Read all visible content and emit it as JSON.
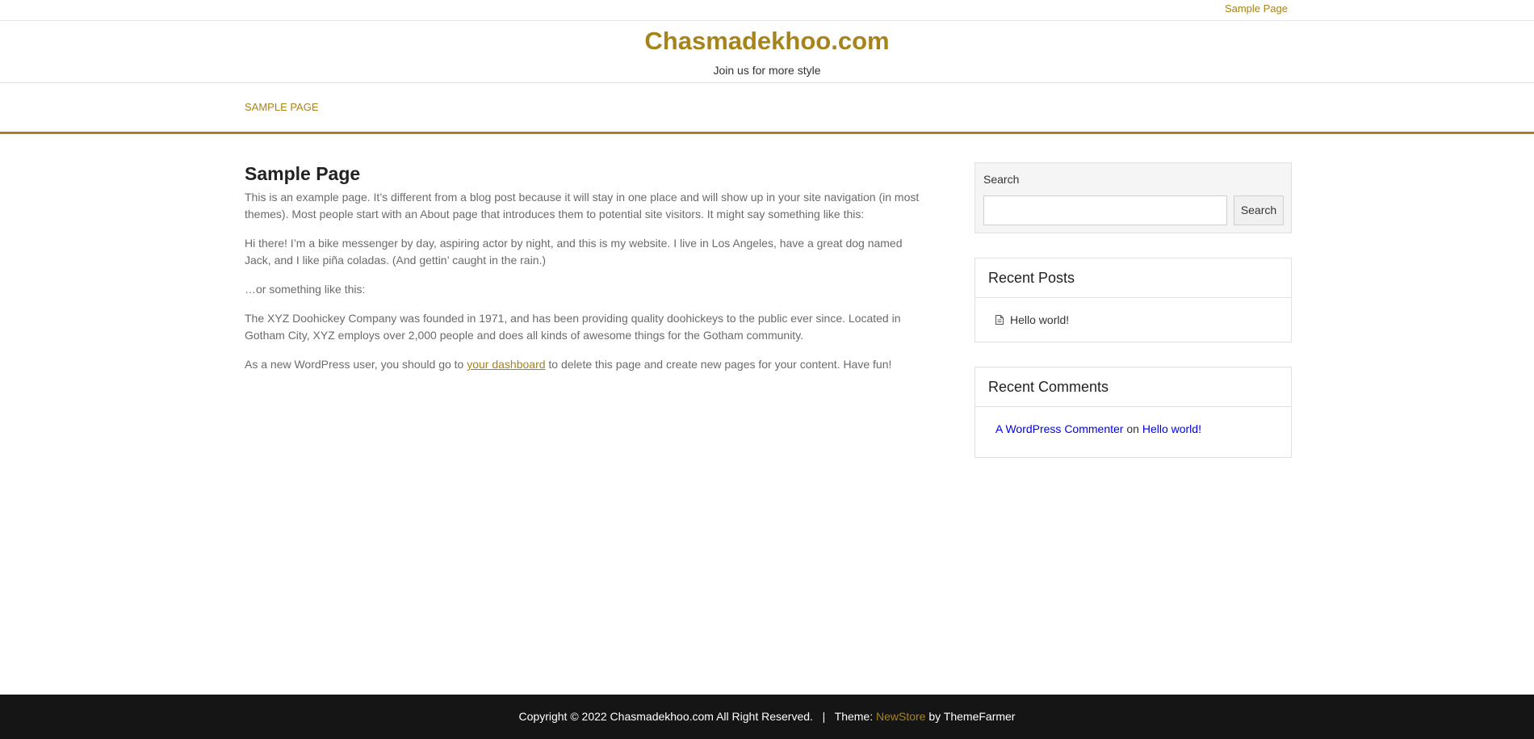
{
  "topbar": {
    "link": "Sample Page"
  },
  "header": {
    "title": "Chasmadekhoo.com",
    "tagline": "Join us for more style"
  },
  "nav": {
    "items": [
      "SAMPLE PAGE"
    ]
  },
  "main": {
    "title": "Sample Page",
    "paragraphs": {
      "p1": "This is an example page. It’s different from a blog post because it will stay in one place and will show up in your site navigation (in most themes). Most people start with an About page that introduces them to potential site visitors. It might say something like this:",
      "p2": "Hi there! I’m a bike messenger by day, aspiring actor by night, and this is my website. I live in Los Angeles, have a great dog named Jack, and I like piña coladas. (And gettin’ caught in the rain.)",
      "p3": "…or something like this:",
      "p4": "The XYZ Doohickey Company was founded in 1971, and has been providing quality doohickeys to the public ever since. Located in Gotham City, XYZ employs over 2,000 people and does all kinds of awesome things for the Gotham community.",
      "p5_before": "As a new WordPress user, you should go to ",
      "p5_link": "your dashboard",
      "p5_after": " to delete this page and create new pages for your content. Have fun!"
    }
  },
  "sidebar": {
    "search": {
      "label": "Search",
      "button": "Search",
      "value": ""
    },
    "recent_posts": {
      "title": "Recent Posts",
      "items": [
        "Hello world!"
      ],
      "icon": "document-icon"
    },
    "recent_comments": {
      "title": "Recent Comments",
      "author": "A WordPress Commenter",
      "on": "on",
      "post": "Hello world!"
    }
  },
  "footer": {
    "copyright": "Copyright © 2022 Chasmadekhoo.com All Right Reserved.",
    "separator": "|",
    "theme_prefix": "Theme:",
    "theme_link": "NewStore",
    "theme_suffix": "by ThemeFarmer"
  },
  "colors": {
    "accent": "#a7831c",
    "footer_bg": "#151515"
  }
}
